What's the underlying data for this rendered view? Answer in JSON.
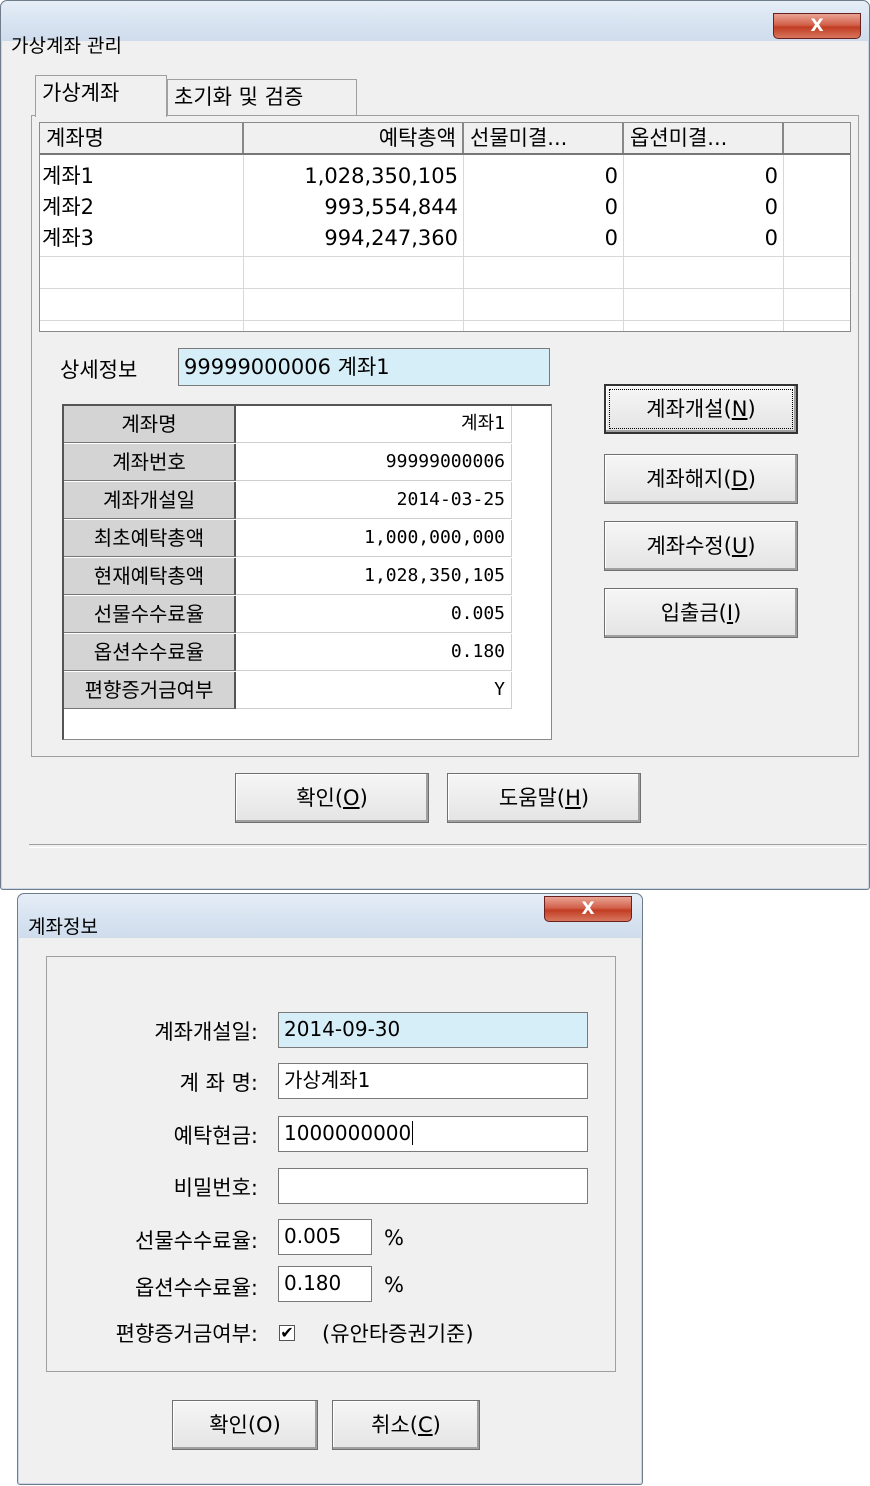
{
  "main_window": {
    "title": "가상계좌 관리",
    "close_label": "X",
    "tabs": [
      "가상계좌",
      "초기화 및 검증"
    ],
    "list": {
      "columns": [
        "계좌명",
        "예탁총액",
        "선물미결...",
        "옵션미결..."
      ],
      "rows": [
        [
          "계좌1",
          "1,028,350,105",
          "0",
          "0"
        ],
        [
          "계좌2",
          "993,554,844",
          "0",
          "0"
        ],
        [
          "계좌3",
          "994,247,360",
          "0",
          "0"
        ]
      ]
    },
    "detail": {
      "label": "상세정보",
      "value": "99999000006 계좌1",
      "grid": [
        {
          "key": "계좌명",
          "value": "계좌1"
        },
        {
          "key": "계좌번호",
          "value": "99999000006"
        },
        {
          "key": "계좌개설일",
          "value": "2014-03-25"
        },
        {
          "key": "최초예탁총액",
          "value": "1,000,000,000"
        },
        {
          "key": "현재예탁총액",
          "value": "1,028,350,105"
        },
        {
          "key": "선물수수료율",
          "value": "0.005"
        },
        {
          "key": "옵션수수료율",
          "value": "0.180"
        },
        {
          "key": "편향증거금여부",
          "value": "Y"
        }
      ]
    },
    "side_buttons": [
      {
        "text": "계좌개설(",
        "key": "N",
        "suffix": ")"
      },
      {
        "text": "계좌해지(",
        "key": "D",
        "suffix": ")"
      },
      {
        "text": "계좌수정(",
        "key": "U",
        "suffix": ")"
      },
      {
        "text": "입출금(",
        "key": "I",
        "suffix": ")"
      }
    ],
    "bottom_buttons": [
      {
        "text": "확인(",
        "key": "O",
        "suffix": ")"
      },
      {
        "text": "도움말(",
        "key": "H",
        "suffix": ")"
      }
    ]
  },
  "dialog": {
    "title": "계좌정보",
    "close_label": "X",
    "fields": {
      "open_date": {
        "label": "계좌개설일:",
        "value": "2014-09-30"
      },
      "account_name": {
        "label": "계 좌 명:",
        "value": "가상계좌1"
      },
      "deposit": {
        "label": "예탁현금:",
        "value": "1000000000"
      },
      "password": {
        "label": "비밀번호:",
        "value": ""
      },
      "futures_fee": {
        "label": "선물수수료율:",
        "value": "0.005",
        "unit": "%"
      },
      "options_fee": {
        "label": "옵션수수료율:",
        "value": "0.180",
        "unit": "%"
      },
      "bias_margin": {
        "label": "편향증거금여부:",
        "checked": true,
        "note": "(유안타증권기준)"
      }
    },
    "ok_label": "확인(O)",
    "cancel_text": "취소(",
    "cancel_key": "C",
    "cancel_suffix": ")"
  }
}
